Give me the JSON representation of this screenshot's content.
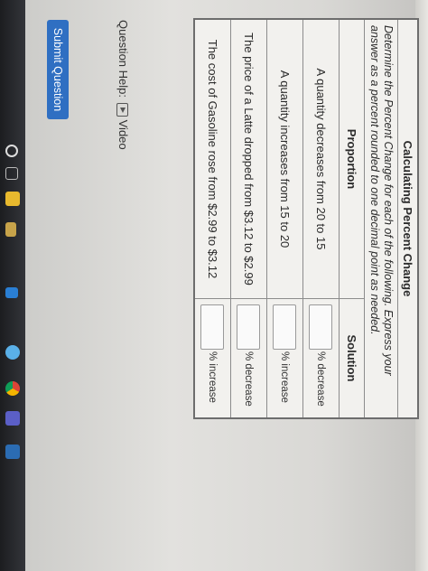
{
  "table": {
    "title": "Calculating Percent Change",
    "instructions": "Determine the Percent Change for each of the following. Express your answer as a percent rounded to one decimal point as needed.",
    "header_proportion": "Proportion",
    "header_solution": "Solution",
    "rows": [
      {
        "proportion": "A quantity decreases from 20 to 15",
        "unit": "% decrease"
      },
      {
        "proportion": "A quantity increases from 15 to 20",
        "unit": "% increase"
      },
      {
        "proportion": "The price of a Latte dropped from $3.12 to $2.99",
        "unit": "% decrease"
      },
      {
        "proportion": "The cost of Gasoline rose from $2.99 to $3.12",
        "unit": "% increase"
      }
    ]
  },
  "help": {
    "label": "Question Help:",
    "video_label": "Video"
  },
  "submit_label": "Submit Question",
  "colors": {
    "button": "#2f6fc2",
    "page": "#f2f1ee",
    "taskbar": "#1c1d20"
  },
  "taskbar_icons": [
    "search-icon",
    "task-view-icon",
    "file-explorer-icon",
    "store-icon",
    "mail-icon",
    "edge-icon",
    "chrome-icon",
    "teams-icon",
    "word-icon"
  ]
}
